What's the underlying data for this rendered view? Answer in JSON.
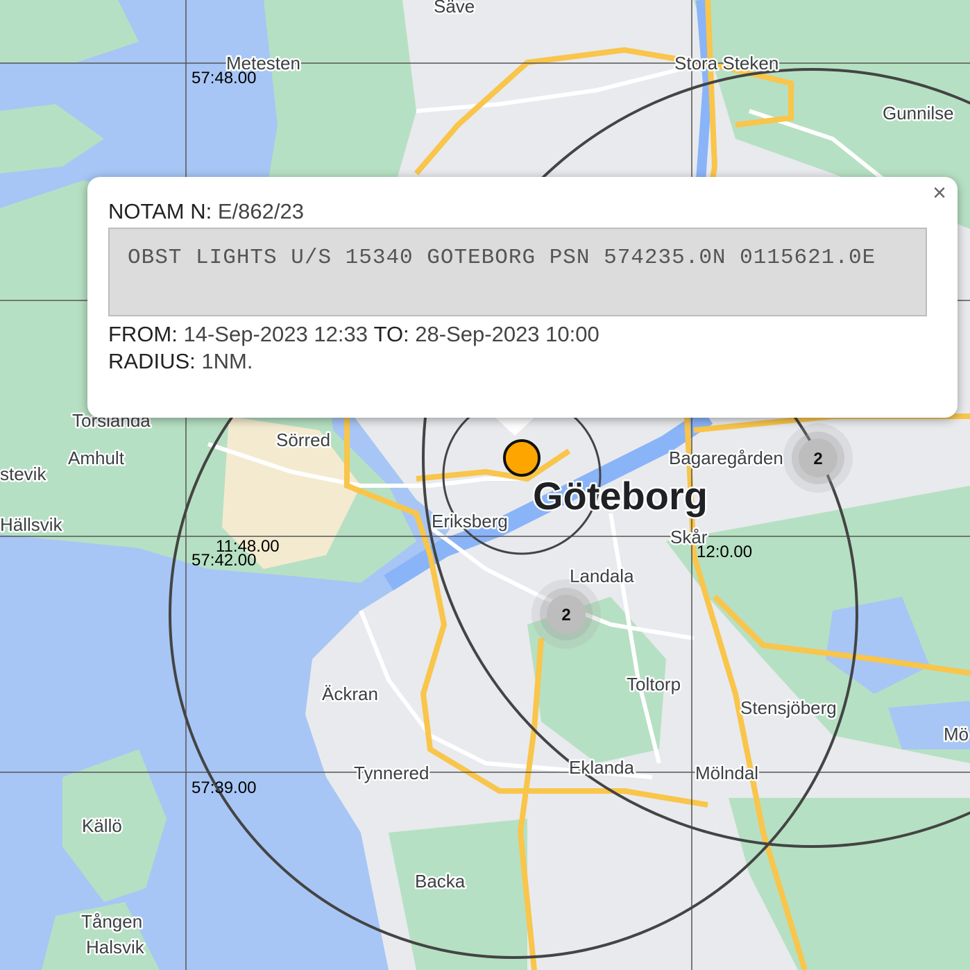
{
  "map": {
    "city": "Göteborg",
    "places": [
      "Säve",
      "Metesten",
      "Stora Steken",
      "Gunnilse",
      "Torslanda",
      "Sörred",
      "Amhult",
      "stevik",
      "Hällsvik",
      "Bagaregården",
      "Eriksberg",
      "Skår",
      "Landala",
      "Toltorp",
      "Stensjöberg",
      "Äckran",
      "Tynnered",
      "Eklanda",
      "Mölndal",
      "Källö",
      "Backa",
      "Tången",
      "Halsvik",
      "Mö"
    ],
    "grid_labels": [
      "57:48.00",
      "57:42.00",
      "11:48.00",
      "12:0.00",
      "57:39.00"
    ],
    "clusters": [
      {
        "count": "2",
        "icon": "cluster-marker"
      },
      {
        "count": "2",
        "icon": "cluster-marker"
      }
    ],
    "marker": {
      "icon": "notam-point-marker",
      "color": "#ffa500"
    },
    "colors": {
      "water": "#a7c6f5",
      "land": "#e8eaed",
      "park": "#b6e0c3",
      "road_major": "#f9c54a",
      "road": "#ffffff",
      "circle": "#444444"
    }
  },
  "popup": {
    "notam_label": "NOTAM N:",
    "notam_id": "E/862/23",
    "text": "OBST LIGHTS U/S 15340 GOTEBORG PSN 574235.0N 0115621.0E",
    "from_label": "FROM:",
    "from_value": "14-Sep-2023 12:33",
    "to_label": "TO:",
    "to_value": "28-Sep-2023 10:00",
    "radius_label": "RADIUS:",
    "radius_value": "1NM.",
    "close_icon": "×"
  }
}
